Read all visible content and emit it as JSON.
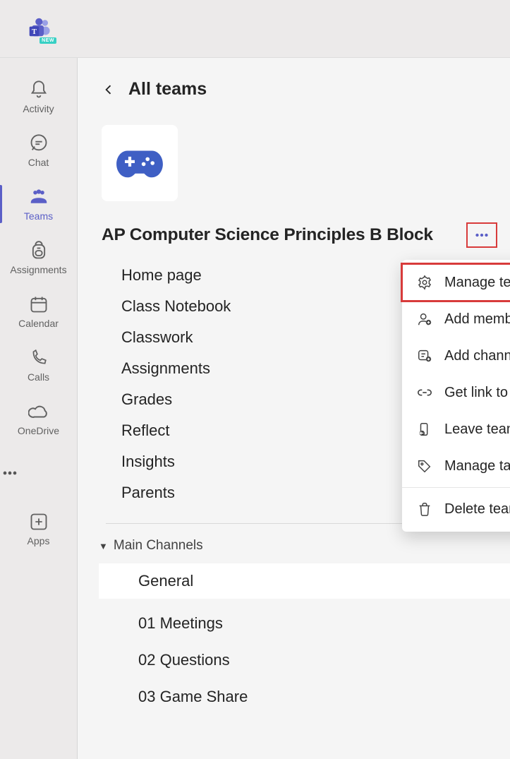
{
  "header": {
    "new_badge": "NEW"
  },
  "rail": {
    "activity": "Activity",
    "chat": "Chat",
    "teams": "Teams",
    "assignments": "Assignments",
    "calendar": "Calendar",
    "calls": "Calls",
    "onedrive": "OneDrive",
    "apps": "Apps"
  },
  "breadcrumb": {
    "all_teams": "All teams"
  },
  "team": {
    "title": "AP Computer Science Principles B Block",
    "sections": [
      "Home page",
      "Class Notebook",
      "Classwork",
      "Assignments",
      "Grades",
      "Reflect",
      "Insights",
      "Parents"
    ]
  },
  "channels": {
    "group_label": "Main Channels",
    "items": [
      "General",
      "01 Meetings",
      "02 Questions",
      "03 Game Share"
    ]
  },
  "menu": {
    "manage_team": "Manage team",
    "add_member": "Add member",
    "add_channel": "Add channel",
    "get_link": "Get link to team",
    "leave_team": "Leave team",
    "manage_tags": "Manage tags",
    "delete_team": "Delete team"
  }
}
